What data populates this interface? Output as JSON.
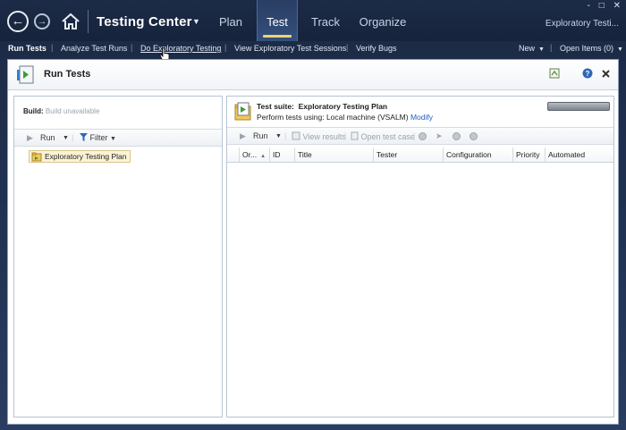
{
  "nav": {
    "back_icon": "arrow-left-icon",
    "forward_icon": "arrow-right-icon",
    "home_icon": "home-icon",
    "app_title": "Testing Center",
    "title_dropdown_icon": "triangle-down-icon",
    "tabs": [
      {
        "label": "Plan"
      },
      {
        "label": "Test"
      },
      {
        "label": "Track"
      },
      {
        "label": "Organize"
      }
    ],
    "active_tab": "Test",
    "project_label": "Exploratory Testi...",
    "window_controls": [
      "-",
      "□",
      "✕"
    ]
  },
  "subnav": {
    "items": [
      {
        "label": "Run Tests"
      },
      {
        "label": "Analyze Test Runs"
      },
      {
        "label": "Do Exploratory Testing"
      },
      {
        "label": "View Exploratory Test Sessions"
      },
      {
        "label": "Verify Bugs"
      }
    ],
    "new_label": "New",
    "open_items_label": "Open Items (0)"
  },
  "panel": {
    "title": "Run Tests",
    "tools": [
      "refresh-icon",
      "help-icon",
      "close-icon"
    ]
  },
  "left": {
    "build_label": "Build:",
    "build_value": "Build unavailable",
    "run_label": "Run",
    "filter_label": "Filter",
    "tree_item": "Exploratory Testing Plan"
  },
  "right": {
    "suite_label": "Test suite:",
    "suite_name": "Exploratory Testing Plan",
    "perform_text": "Perform tests using: Local machine (VSALM)",
    "modify_link": "Modify",
    "run_label": "Run",
    "view_results_label": "View results",
    "open_test_case_label": "Open test case",
    "columns": [
      "Or...",
      "ID",
      "Title",
      "Tester",
      "Configuration",
      "Priority",
      "Automated"
    ]
  },
  "colors": {
    "background": "#1b2a44",
    "active_tab_accent": "#f2d36a",
    "link": "#1f5fbf"
  }
}
